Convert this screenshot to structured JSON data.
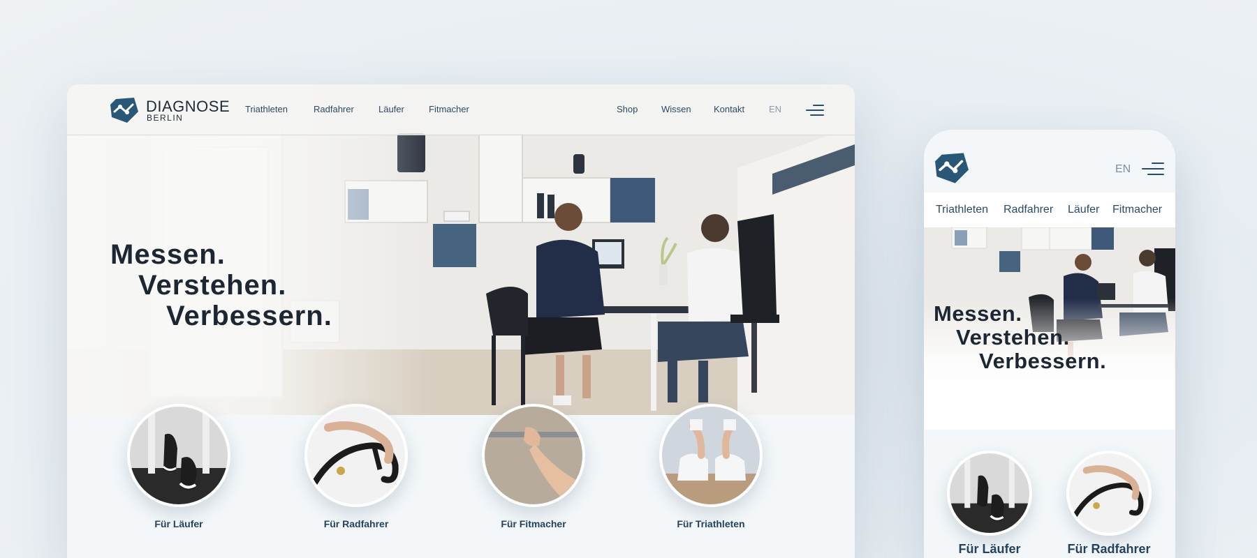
{
  "desktop": {
    "brand": {
      "name": "DIAGNOSE",
      "city": "BERLIN"
    },
    "nav_left": [
      "Triathleten",
      "Radfahrer",
      "Läufer",
      "Fitmacher"
    ],
    "nav_right": [
      "Shop",
      "Wissen",
      "Kontakt"
    ],
    "language": "EN",
    "headline": [
      "Messen.",
      "Verstehen.",
      "Verbessern."
    ],
    "categories": [
      {
        "label": "Für Läufer",
        "icon": "runner-shoes-photo"
      },
      {
        "label": "Für Radfahrer",
        "icon": "bike-handlebar-photo"
      },
      {
        "label": "Für Fitmacher",
        "icon": "barbell-grip-photo"
      },
      {
        "label": "Für Triathleten",
        "icon": "tying-shoes-photo"
      }
    ]
  },
  "mobile": {
    "language": "EN",
    "nav": [
      "Triathleten",
      "Radfahrer",
      "Läufer",
      "Fitmacher"
    ],
    "headline": [
      "Messen.",
      "Verstehen.",
      "Verbessern."
    ],
    "categories": [
      {
        "label": "Für Läufer",
        "icon": "runner-shoes-photo"
      },
      {
        "label": "Für Radfahrer",
        "icon": "bike-handlebar-photo"
      }
    ]
  },
  "colors": {
    "brand": "#2a5778",
    "text_dark": "#1d2733",
    "nav_text": "#2c4a66",
    "page_bg": "#e6ecf1"
  }
}
